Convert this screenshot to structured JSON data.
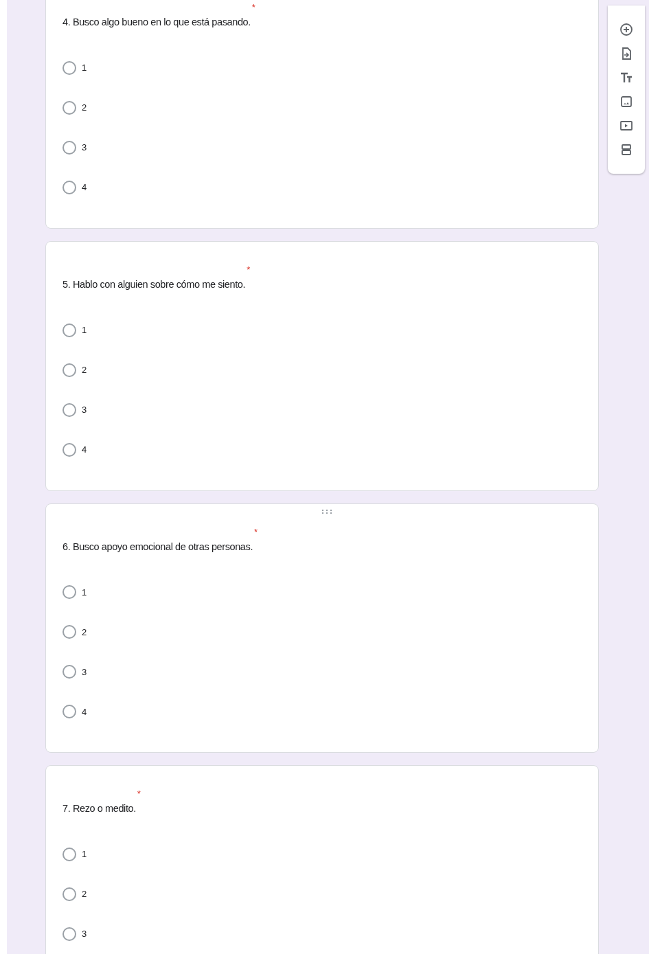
{
  "questions": [
    {
      "text": "4. Busco algo bueno en lo que está pasando.",
      "required": true,
      "required_mark": "*",
      "drag_handle": false,
      "options": [
        {
          "label": "1",
          "selected": false
        },
        {
          "label": "2",
          "selected": false
        },
        {
          "label": "3",
          "selected": false
        },
        {
          "label": "4",
          "selected": false
        }
      ]
    },
    {
      "text": "5. Hablo con alguien sobre cómo me siento.",
      "required": true,
      "required_mark": "*",
      "drag_handle": false,
      "options": [
        {
          "label": "1",
          "selected": false
        },
        {
          "label": "2",
          "selected": false
        },
        {
          "label": "3",
          "selected": false
        },
        {
          "label": "4",
          "selected": false
        }
      ]
    },
    {
      "text": "6. Busco apoyo emocional de otras personas.",
      "required": true,
      "required_mark": "*",
      "drag_handle": true,
      "options": [
        {
          "label": "1",
          "selected": false
        },
        {
          "label": "2",
          "selected": false
        },
        {
          "label": "3",
          "selected": false
        },
        {
          "label": "4",
          "selected": false
        }
      ]
    },
    {
      "text": "7. Rezo o medito.",
      "required": true,
      "required_mark": "*",
      "drag_handle": false,
      "options": [
        {
          "label": "1",
          "selected": false
        },
        {
          "label": "2",
          "selected": false
        },
        {
          "label": "3",
          "selected": false
        }
      ]
    }
  ],
  "toolbar": [
    {
      "kind": "add"
    },
    {
      "kind": "import"
    },
    {
      "kind": "title"
    },
    {
      "kind": "image"
    },
    {
      "kind": "video"
    },
    {
      "kind": "section"
    }
  ]
}
